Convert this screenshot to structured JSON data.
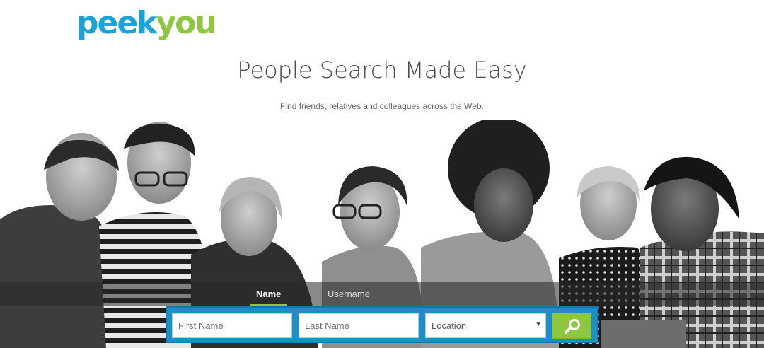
{
  "logo": {
    "part1": "peek",
    "part2": "you"
  },
  "headline": "People Search Made Easy",
  "subline": "Find friends, relatives and colleagues across the Web.",
  "tabs": [
    {
      "label": "Name",
      "active": true
    },
    {
      "label": "Username",
      "active": false
    }
  ],
  "search": {
    "first_placeholder": "First Name",
    "last_placeholder": "Last Name",
    "location_selected": "Location",
    "submit_icon": "search-icon"
  },
  "colors": {
    "brand_blue": "#1aa3d8",
    "brand_green": "#8dc63f",
    "search_bar": "#1a8fc8"
  }
}
